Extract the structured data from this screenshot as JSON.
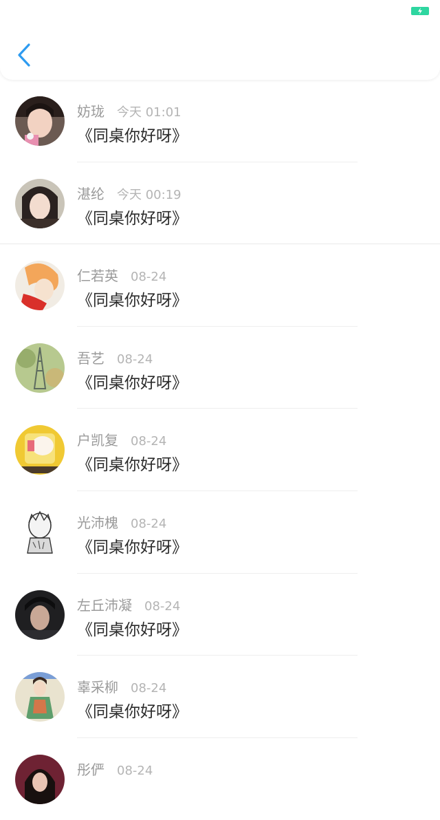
{
  "status_bar": {
    "battery_icon": "battery-charging-icon",
    "battery_color": "#2ed6a0"
  },
  "header": {
    "back_icon": "chevron-left-icon",
    "accent_color": "#2d9bf0"
  },
  "items": [
    {
      "name": "妨珑",
      "time": "今天 01:01",
      "message": "《同桌你好呀》"
    },
    {
      "name": "湛纶",
      "time": "今天 00:19",
      "message": "《同桌你好呀》"
    },
    {
      "name": "仁若英",
      "time": "08-24",
      "message": "《同桌你好呀》"
    },
    {
      "name": "吾艺",
      "time": "08-24",
      "message": "《同桌你好呀》"
    },
    {
      "name": "户凯复",
      "time": "08-24",
      "message": "《同桌你好呀》"
    },
    {
      "name": "光沛槐",
      "time": "08-24",
      "message": "《同桌你好呀》"
    },
    {
      "name": "左丘沛凝",
      "time": "08-24",
      "message": "《同桌你好呀》"
    },
    {
      "name": "辜采柳",
      "time": "08-24",
      "message": "《同桌你好呀》"
    },
    {
      "name": "彤俨",
      "time": "08-24",
      "message": ""
    }
  ]
}
